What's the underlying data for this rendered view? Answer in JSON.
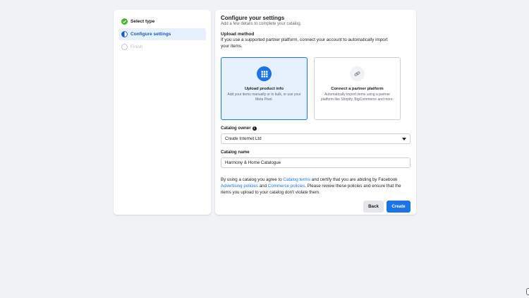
{
  "steps": [
    {
      "label": "Select type",
      "state": "complete"
    },
    {
      "label": "Configure settings",
      "state": "current"
    },
    {
      "label": "Finish",
      "state": "pending"
    }
  ],
  "panel": {
    "title": "Configure your settings",
    "subtitle": "Add a few details to complete your catalog."
  },
  "upload_method": {
    "title": "Upload method",
    "description": "If you use a supported partner platform, connect your account to automatically import your items.",
    "options": [
      {
        "title": "Upload product info",
        "description": "Add your items manually or in bulk, or use your Meta Pixel.",
        "icon": "grid-icon",
        "selected": true
      },
      {
        "title": "Connect a partner platform",
        "description": "Automatically import items using a partner platform like Shopify, BigCommerce and more.",
        "icon": "link-icon",
        "selected": false
      }
    ]
  },
  "catalog_owner": {
    "label": "Catalog owner",
    "value": "Create Internet Ltd"
  },
  "catalog_name": {
    "label": "Catalog name",
    "value": "Harmony & Home Catalogue"
  },
  "terms": {
    "part1": "By using a catalog you agree to ",
    "link1": "Catalog terms",
    "part2": " and certify that you are abiding by Facebook ",
    "link2": "Advertising policies",
    "part3": " and ",
    "link3": "Commerce policies",
    "part4": ". Please review these policies and ensure that the items you upload to your catalog don't violate them."
  },
  "buttons": {
    "back": "Back",
    "create": "Create"
  },
  "colors": {
    "accent": "#1b74e4",
    "complete": "#42b72a",
    "background": "#f0f2f5"
  }
}
